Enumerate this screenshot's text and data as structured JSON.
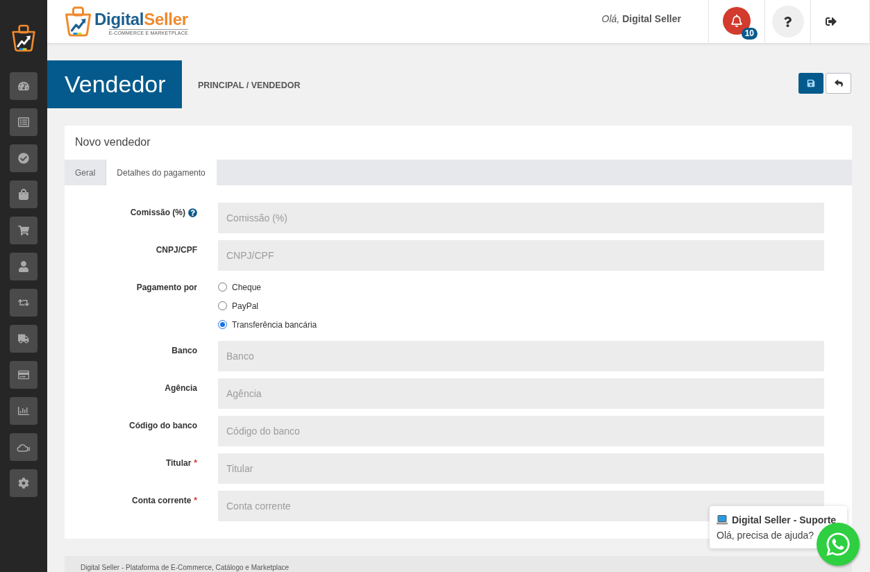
{
  "header": {
    "logo": {
      "title_parts": [
        "Digital",
        "Seller"
      ],
      "tagline": "E-COMMERCE E MARKETPLACE"
    },
    "greeting": "*Olá,* **Digital Seller**",
    "notifications": {
      "count": "10"
    }
  },
  "page": {
    "title": "Vendedor",
    "breadcrumb": "PRINCIPAL / VENDEDOR"
  },
  "card": {
    "title": "Novo vendedor",
    "tabs": [
      {
        "label": "Geral",
        "selected": false
      },
      {
        "label": "Detalhes do pagamento",
        "selected": true
      }
    ],
    "fields": [
      {
        "kind": "input",
        "label": "Comissão (%)",
        "help": true,
        "placeholder": "Comissão (%)"
      },
      {
        "kind": "input",
        "label": "CNPJ/CPF",
        "help": false,
        "placeholder": "CNPJ/CPF"
      },
      {
        "kind": "radio",
        "label": "Pagamento por",
        "options": [
          {
            "label": "Cheque",
            "selected": false
          },
          {
            "label": "PayPal",
            "selected": false
          },
          {
            "label": "Transferência bancária",
            "selected": true
          }
        ]
      },
      {
        "kind": "input",
        "label": "Banco",
        "help": false,
        "placeholder": "Banco"
      },
      {
        "kind": "input",
        "label": "Agência",
        "help": false,
        "placeholder": "Agência"
      },
      {
        "kind": "input",
        "label": "Código do banco",
        "help": false,
        "placeholder": "Código do banco"
      },
      {
        "kind": "input",
        "label": "Titular",
        "help": false,
        "required_mark": "*",
        "placeholder": "Titular"
      },
      {
        "kind": "input",
        "label": "Conta corrente",
        "help": false,
        "required_mark": "*",
        "placeholder": "Conta corrente"
      }
    ]
  },
  "chat": {
    "title": "Digital Seller - Suporte",
    "message": "Olá, precisa de ajuda?"
  },
  "footer": {
    "text": "Digital Seller - Plataforma de E-Commerce, Catálogo e Marketplace"
  }
}
